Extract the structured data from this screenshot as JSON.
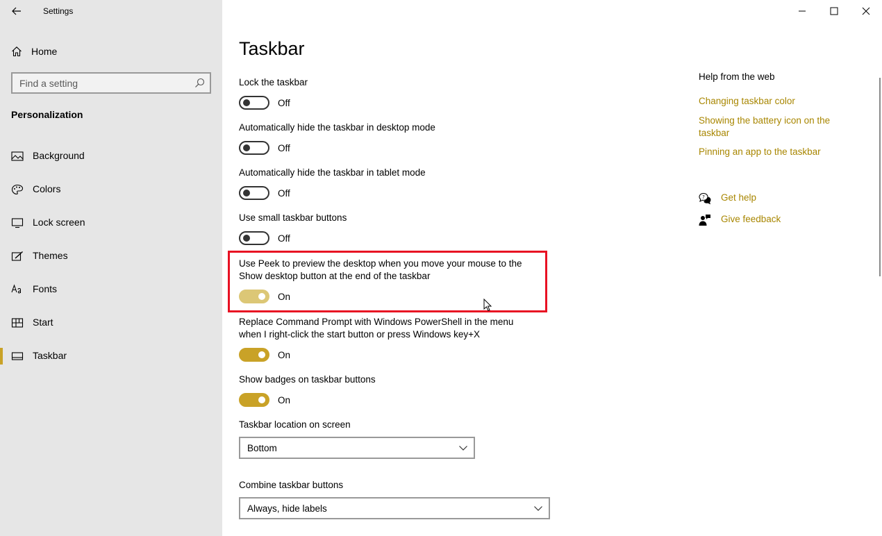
{
  "window": {
    "app_title": "Settings"
  },
  "sidebar": {
    "home_label": "Home",
    "search_placeholder": "Find a setting",
    "section_title": "Personalization",
    "items": [
      {
        "label": "Background",
        "icon": "image-icon"
      },
      {
        "label": "Colors",
        "icon": "palette-icon"
      },
      {
        "label": "Lock screen",
        "icon": "monitor-icon"
      },
      {
        "label": "Themes",
        "icon": "brush-icon"
      },
      {
        "label": "Fonts",
        "icon": "font-icon"
      },
      {
        "label": "Start",
        "icon": "start-icon"
      },
      {
        "label": "Taskbar",
        "icon": "taskbar-icon",
        "active": true
      }
    ]
  },
  "main": {
    "title": "Taskbar",
    "settings": [
      {
        "label": "Lock the taskbar",
        "state": "Off",
        "on": false
      },
      {
        "label": "Automatically hide the taskbar in desktop mode",
        "state": "Off",
        "on": false
      },
      {
        "label": "Automatically hide the taskbar in tablet mode",
        "state": "Off",
        "on": false
      },
      {
        "label": "Use small taskbar buttons",
        "state": "Off",
        "on": false
      },
      {
        "label": "Use Peek to preview the desktop when you move your mouse to the Show desktop button at the end of the taskbar",
        "state": "On",
        "on": true
      },
      {
        "label": "Replace Command Prompt with Windows PowerShell in the menu when I right-click the start button or press Windows key+X",
        "state": "On",
        "on": true
      },
      {
        "label": "Show badges on taskbar buttons",
        "state": "On",
        "on": true
      }
    ],
    "location": {
      "label": "Taskbar location on screen",
      "value": "Bottom"
    },
    "combine": {
      "label": "Combine taskbar buttons",
      "value": "Always, hide labels"
    }
  },
  "help": {
    "title": "Help from the web",
    "links": [
      "Changing taskbar color",
      "Showing the battery icon on the taskbar",
      "Pinning an app to the taskbar"
    ],
    "get_help": "Get help",
    "give_feedback": "Give feedback"
  },
  "colors": {
    "accent": "#c9a227",
    "link": "#a88600",
    "highlight": "#e81123"
  }
}
